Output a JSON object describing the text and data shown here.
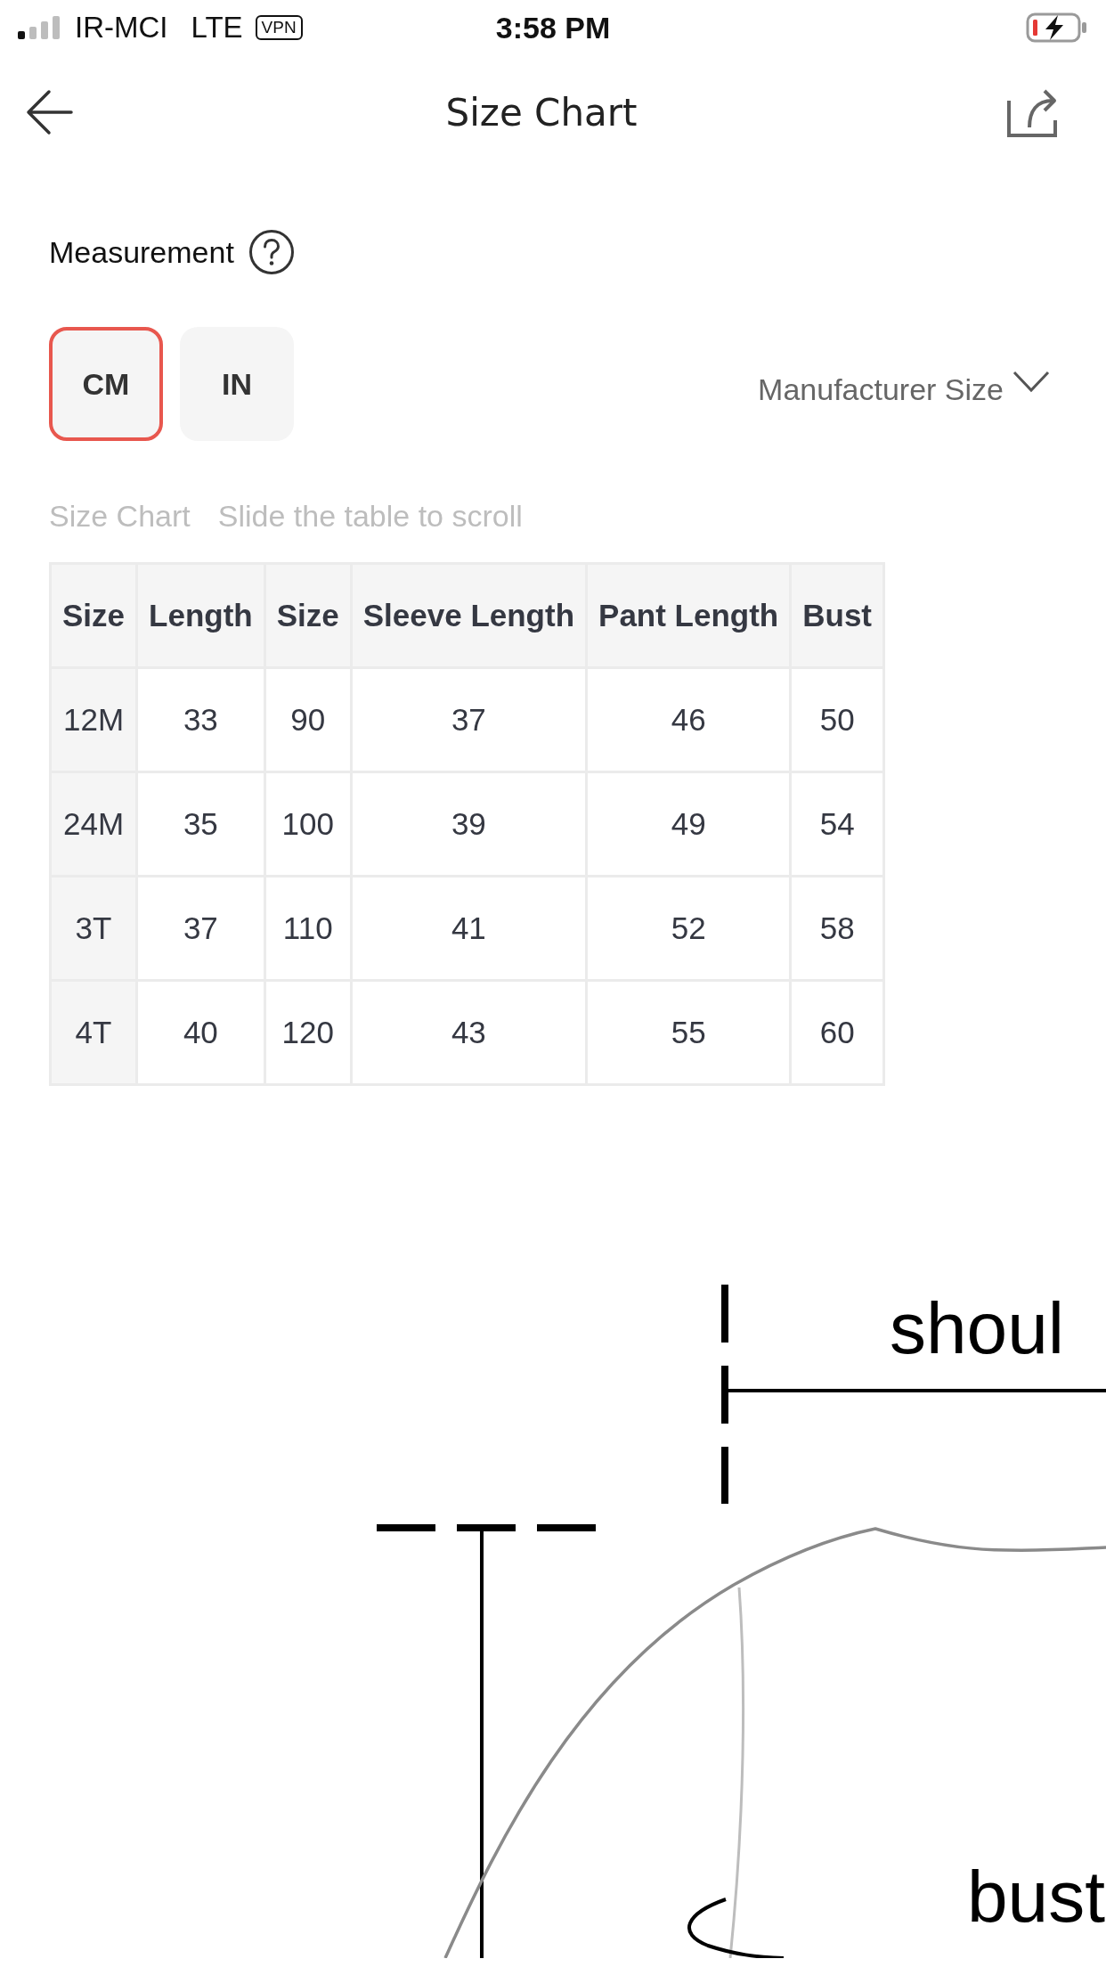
{
  "status_bar": {
    "carrier": "IR-MCI",
    "network": "LTE",
    "vpn": "VPN",
    "time": "3:58 PM"
  },
  "header": {
    "title": "Size Chart"
  },
  "measurement": {
    "label": "Measurement",
    "units": [
      {
        "label": "CM",
        "selected": true
      },
      {
        "label": "IN",
        "selected": false
      }
    ],
    "size_type": "Manufacturer Size"
  },
  "size_chart": {
    "title": "Size Chart",
    "hint": "Slide the table to scroll",
    "columns": [
      "Size",
      "Length",
      "Size",
      "Sleeve Length",
      "Pant Length",
      "Bust"
    ],
    "rows": [
      [
        "12M",
        "33",
        "90",
        "37",
        "46",
        "50"
      ],
      [
        "24M",
        "35",
        "100",
        "39",
        "49",
        "54"
      ],
      [
        "3T",
        "37",
        "110",
        "41",
        "52",
        "58"
      ],
      [
        "4T",
        "40",
        "120",
        "43",
        "55",
        "60"
      ]
    ]
  },
  "diagram": {
    "labels": [
      "shoul",
      "bust"
    ]
  }
}
